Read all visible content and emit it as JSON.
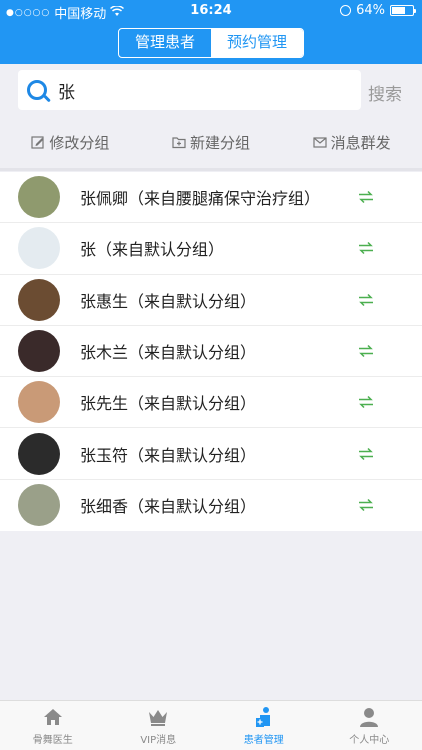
{
  "status": {
    "carrier": "中国移动",
    "time": "16:24",
    "battery": "64%",
    "battery_level": 0.64
  },
  "segment": {
    "items": [
      "管理患者",
      "预约管理"
    ],
    "active_index": 1
  },
  "search": {
    "value": "张",
    "button": "搜索"
  },
  "actions": {
    "edit_group": "修改分组",
    "new_group": "新建分组",
    "broadcast": "消息群发"
  },
  "patients": [
    {
      "name": "张佩卿（来自腰腿痛保守治疗组）",
      "avatar": "#8f9a6e"
    },
    {
      "name": "张（来自默认分组）",
      "avatar": "#e4ebf0"
    },
    {
      "name": "张惠生（来自默认分组）",
      "avatar": "#6b4c32"
    },
    {
      "name": "张木兰（来自默认分组）",
      "avatar": "#3a2a2a"
    },
    {
      "name": "张先生（来自默认分组）",
      "avatar": "#c99a77"
    },
    {
      "name": "张玉符（来自默认分组）",
      "avatar": "#2b2b2b"
    },
    {
      "name": "张细香（来自默认分组）",
      "avatar": "#9aa089"
    }
  ],
  "tabs": [
    {
      "label": "骨舞医生",
      "icon": "home-icon"
    },
    {
      "label": "VIP消息",
      "icon": "crown-icon"
    },
    {
      "label": "患者管理",
      "icon": "patient-icon"
    },
    {
      "label": "个人中心",
      "icon": "person-icon"
    }
  ],
  "colors": {
    "primary": "#2196f3",
    "swap": "#4caf50"
  }
}
